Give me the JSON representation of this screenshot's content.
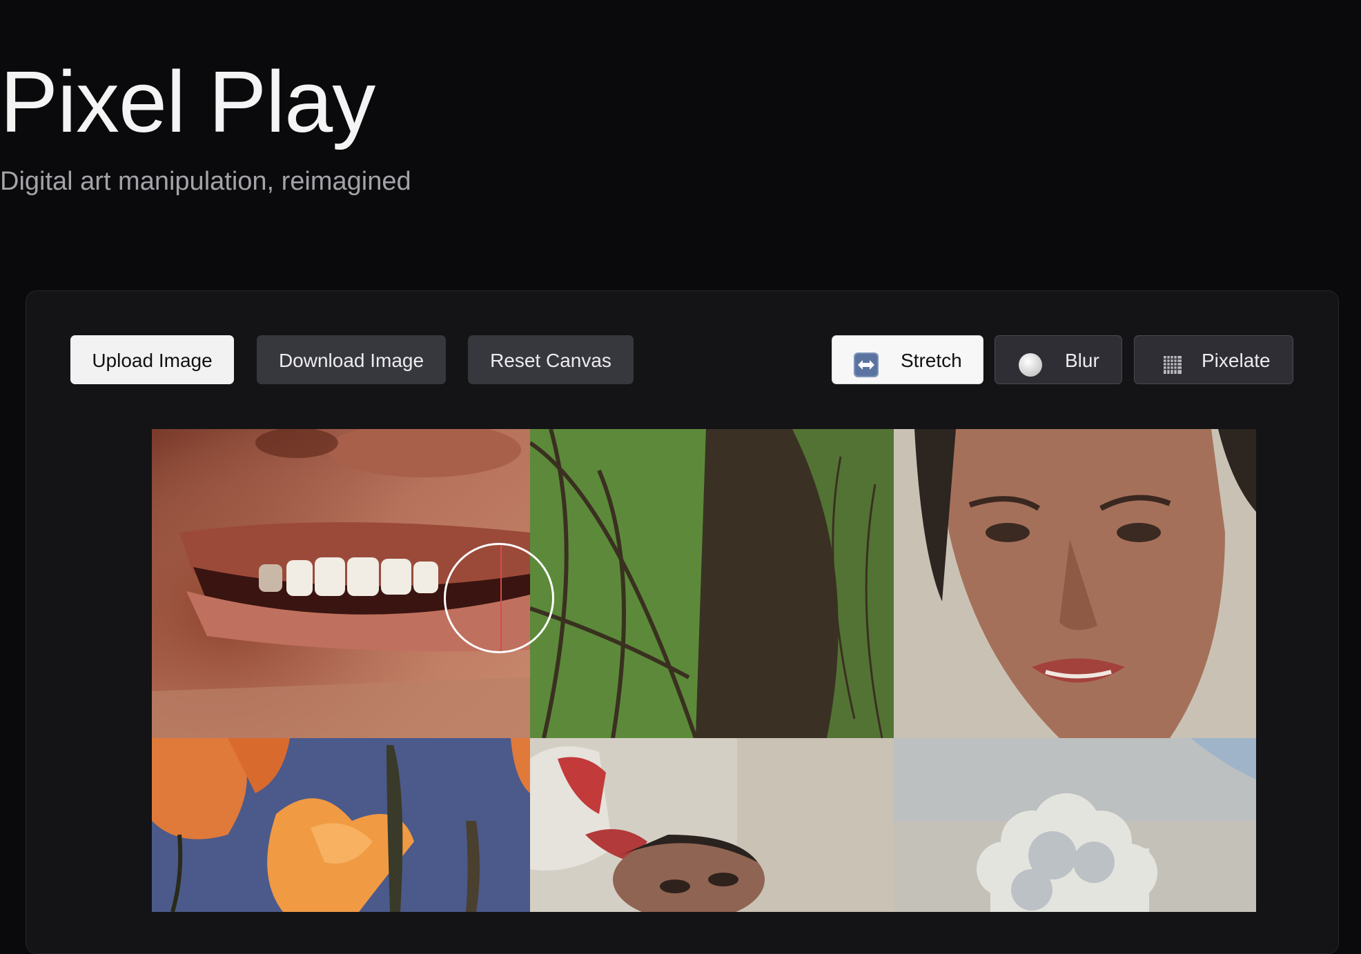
{
  "app": {
    "title": "Pixel Play",
    "subtitle": "Digital art manipulation, reimagined"
  },
  "toolbar": {
    "upload_label": "Upload Image",
    "download_label": "Download Image",
    "reset_label": "Reset Canvas"
  },
  "modes": {
    "active": "Stretch",
    "items": [
      {
        "label": "Stretch",
        "icon": "left-right-arrow-icon",
        "active": true
      },
      {
        "label": "Blur",
        "icon": "white-circle-icon",
        "active": false
      },
      {
        "label": "Pixelate",
        "icon": "grid-icon",
        "active": false
      }
    ]
  },
  "canvas": {
    "tiles": [
      {
        "subject": "smiling-mouth-photo"
      },
      {
        "subject": "green-leaf-photo"
      },
      {
        "subject": "woman-portrait-photo"
      },
      {
        "subject": "orange-flowers-photo"
      },
      {
        "subject": "woman-lying-photo"
      },
      {
        "subject": "clouds-photo"
      }
    ]
  },
  "colors": {
    "background": "#0a0a0d",
    "panel": "#141417",
    "button_dark": "#37373e",
    "button_light": "#f2f2f2"
  }
}
